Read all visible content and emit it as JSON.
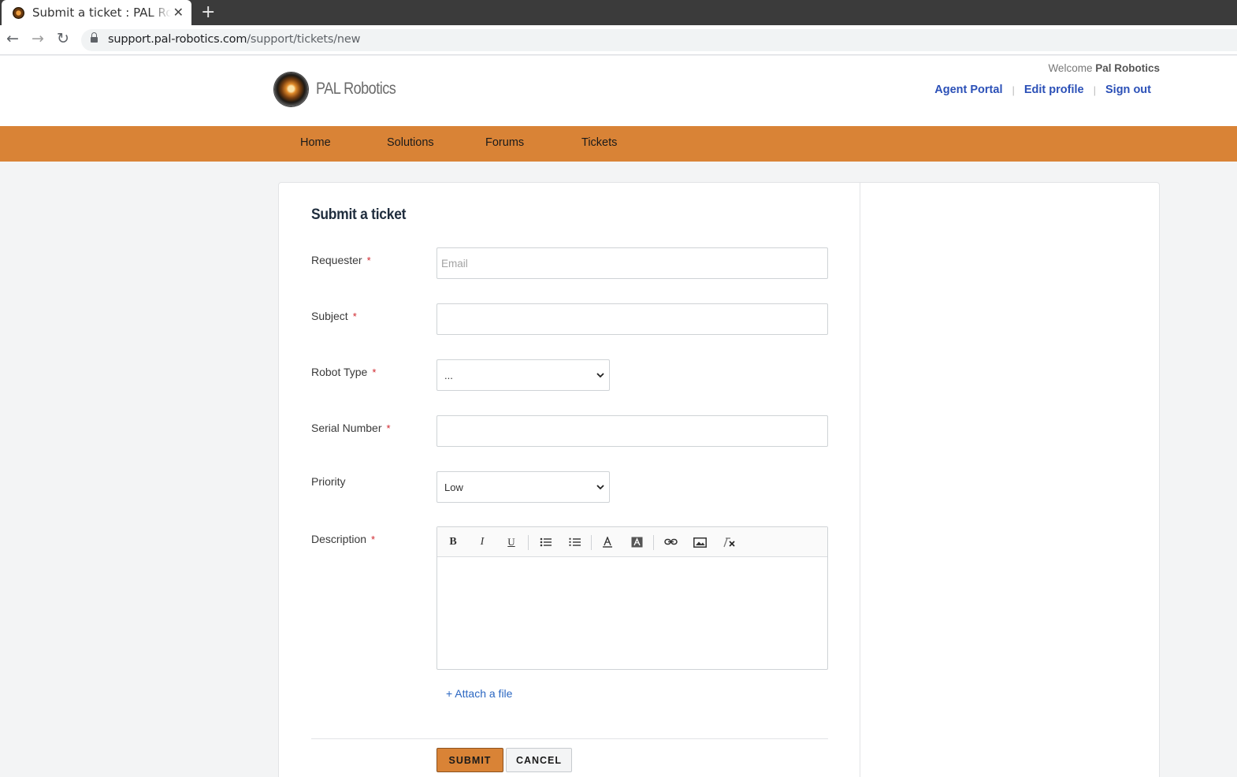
{
  "browser": {
    "tab_title": "Submit a ticket : PAL Robotics",
    "close_glyph": "✕",
    "newtab_glyph": "+",
    "back_glyph": "←",
    "forward_glyph": "→",
    "reload_glyph": "↻",
    "url_host": "support.pal-robotics.com",
    "url_path": "/support/tickets/new"
  },
  "header": {
    "brand": "PAL Robotics",
    "welcome_prefix": "Welcome",
    "welcome_user": "Pal Robotics",
    "links": {
      "agent_portal": "Agent Portal",
      "edit_profile": "Edit profile",
      "sign_out": "Sign out"
    },
    "separator": "|"
  },
  "nav": {
    "home": "Home",
    "solutions": "Solutions",
    "forums": "Forums",
    "tickets": "Tickets"
  },
  "form": {
    "title": "Submit a ticket",
    "required_mark": "*",
    "requester": {
      "label": "Requester",
      "value": "",
      "placeholder": "Email"
    },
    "subject": {
      "label": "Subject",
      "value": ""
    },
    "robot_type": {
      "label": "Robot Type",
      "selected": "..."
    },
    "serial_number": {
      "label": "Serial Number",
      "value": ""
    },
    "priority": {
      "label": "Priority",
      "selected": "Low"
    },
    "description": {
      "label": "Description",
      "value": ""
    },
    "toolbar": {
      "bold": "B",
      "italic": "I",
      "underline": "U"
    },
    "attach_label": "+ Attach a file",
    "submit_label": "SUBMIT",
    "cancel_label": "CANCEL"
  },
  "colors": {
    "accent": "#d98336",
    "link": "#2b50b7",
    "required": "#d0262d"
  }
}
